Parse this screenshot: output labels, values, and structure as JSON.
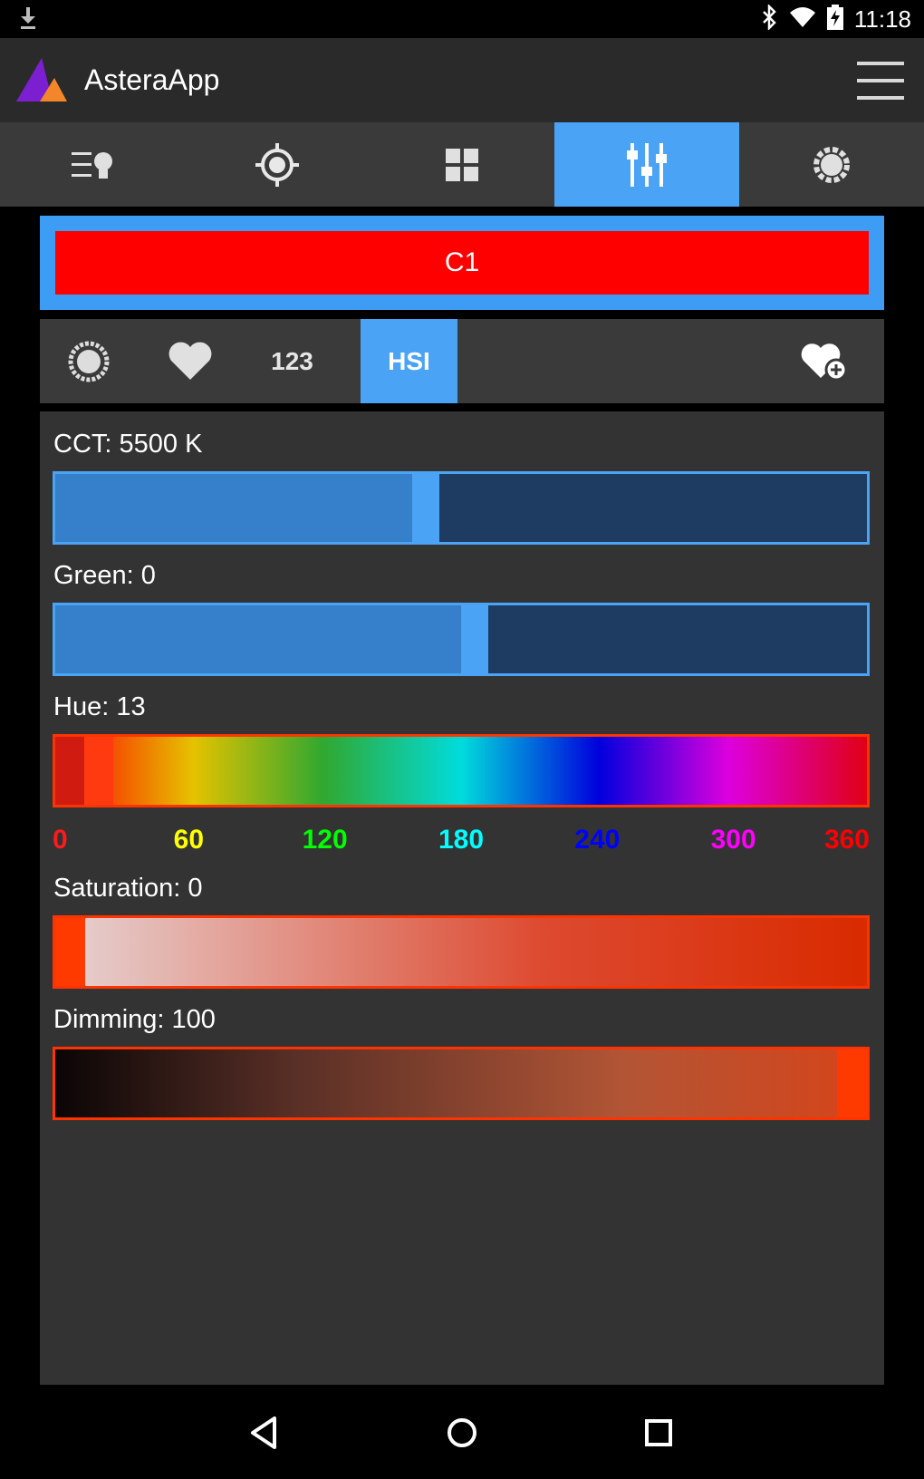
{
  "status_bar": {
    "time": "11:18",
    "icons": [
      "download-icon",
      "bluetooth-icon",
      "wifi-icon",
      "battery-charging-icon"
    ]
  },
  "app_bar": {
    "title": "AsteraApp",
    "logo_colors": [
      "#7b1fd0",
      "#f4862a"
    ],
    "menu_icon": "hamburger-menu-icon"
  },
  "tabs": [
    {
      "icon": "light-list-icon",
      "active": false
    },
    {
      "icon": "target-icon",
      "active": false
    },
    {
      "icon": "grid-icon",
      "active": false
    },
    {
      "icon": "sliders-icon",
      "active": true
    },
    {
      "icon": "sun-settings-icon",
      "active": false
    }
  ],
  "channel": {
    "label": "C1",
    "color": "#ff0000"
  },
  "modes": {
    "picker_icon": "color-wheel-icon",
    "favorites_icon": "heart-icon",
    "numeric_label": "123",
    "hsi_label": "HSI",
    "active": "HSI",
    "add_favorite_icon": "heart-add-icon"
  },
  "sliders": {
    "cct": {
      "label": "CCT: 5500 K",
      "fraction": 0.44
    },
    "green": {
      "label": "Green: 0",
      "fraction": 0.5
    },
    "hue": {
      "label": "Hue: 13",
      "value": 13,
      "max": 360
    },
    "saturation": {
      "label": "Saturation: 0",
      "value": 0
    },
    "dimming": {
      "label": "Dimming: 100",
      "value": 100
    }
  },
  "hue_scale": [
    {
      "text": "0",
      "value": 0,
      "color": "#ff1a1a"
    },
    {
      "text": "60",
      "value": 60,
      "color": "#ffff00"
    },
    {
      "text": "120",
      "value": 120,
      "color": "#00ff00"
    },
    {
      "text": "180",
      "value": 180,
      "color": "#00ffff"
    },
    {
      "text": "240",
      "value": 240,
      "color": "#0000ff"
    },
    {
      "text": "300",
      "value": 300,
      "color": "#ff00ff"
    },
    {
      "text": "360",
      "value": 360,
      "color": "#ff0000"
    }
  ],
  "nav_bar": {
    "icons": [
      "back-icon",
      "home-icon",
      "recents-icon"
    ]
  }
}
